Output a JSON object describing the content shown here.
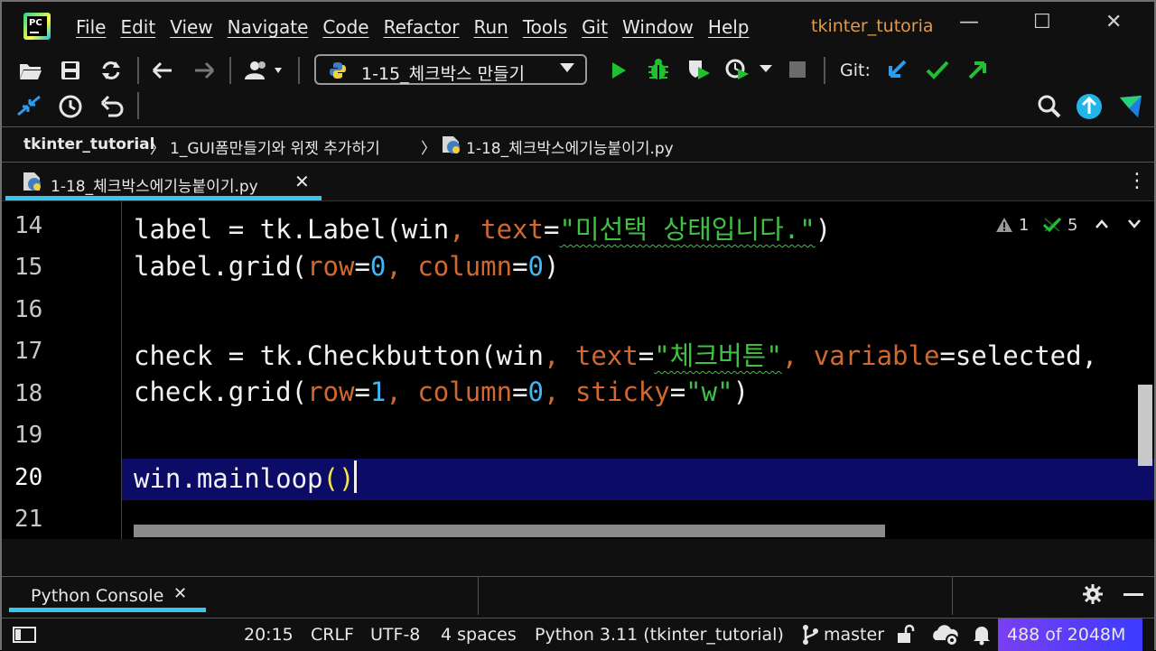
{
  "menubar": {
    "logo_text": "PC",
    "items": [
      "File",
      "Edit",
      "View",
      "Navigate",
      "Code",
      "Refactor",
      "Run",
      "Tools",
      "Git",
      "Window",
      "Help"
    ],
    "project_title": "tkinter_tutoria",
    "minimize": "—",
    "maximize": "☐",
    "close": "✕"
  },
  "toolbar": {
    "run_config": "1-15_체크박스 만들기",
    "git_label": "Git:"
  },
  "breadcrumb": {
    "project": "tkinter_tutorial",
    "folder": "1_GUI폼만들기와 위젯 추가하기",
    "file": "1-18_체크박스에기능붙이기.py",
    "sep": "〉"
  },
  "tab": {
    "label": "1-18_체크박스에기능붙이기.py",
    "close": "✕",
    "more": "⋮"
  },
  "inspection": {
    "warnings": "1",
    "checks": "5"
  },
  "editor": {
    "line_numbers": [
      "14",
      "15",
      "16",
      "17",
      "18",
      "19",
      "20",
      "21"
    ],
    "l14": {
      "a": "label = tk.Label(win",
      "b": ", ",
      "c": "text",
      "d": "=",
      "e": "\"미선택 상태입니다.\"",
      "f": ")"
    },
    "l15": {
      "a": "label.grid(",
      "b": "row",
      "c": "=",
      "d": "0",
      "e": ", ",
      "f": "column",
      "g": "=",
      "h": "0",
      "i": ")"
    },
    "l17": {
      "a": "check = tk.Checkbutton(win",
      "b": ", ",
      "c": "text",
      "d": "=",
      "e": "\"체크버튼\"",
      "f": ", ",
      "g": "variable",
      "h": "=selected,"
    },
    "l18": {
      "a": "check.grid(",
      "b": "row",
      "c": "=",
      "d": "1",
      "e": ", ",
      "f": "column",
      "g": "=",
      "h": "0",
      "i": ", ",
      "j": "sticky",
      "k": "=",
      "l": "\"w\"",
      "m": ")"
    },
    "l20": {
      "a": "win.mainloop",
      "b": "()"
    }
  },
  "console": {
    "tab_label": "Python Console",
    "close": "✕"
  },
  "statusbar": {
    "position": "20:15",
    "line_sep": "CRLF",
    "encoding": "UTF-8",
    "indent": "4 spaces",
    "interpreter": "Python 3.11 (tkinter_tutorial)",
    "branch": "master",
    "memory": "488 of 2048M"
  },
  "colors": {
    "keyword_arg": "#d0682f",
    "number": "#3fb8f5",
    "string": "#3fc244",
    "paren": "#f2e84a",
    "current_line": "#0c0c66",
    "accent": "#3ac6ec",
    "run": "#20c030"
  }
}
